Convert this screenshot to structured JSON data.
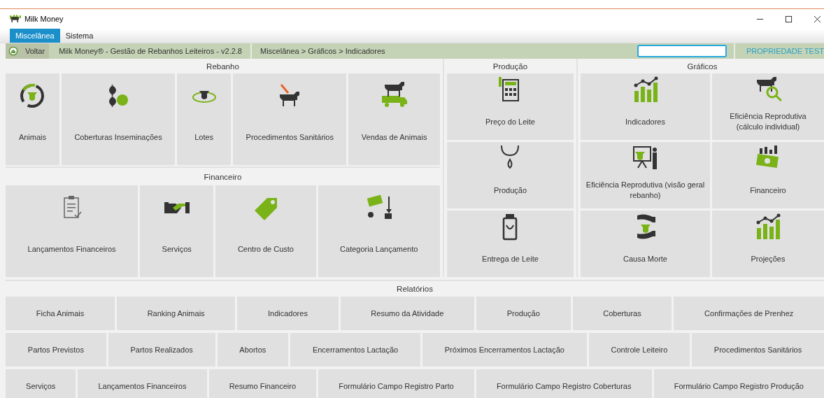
{
  "window": {
    "title": "Milk Money"
  },
  "menu": [
    {
      "label": "Miscelânea",
      "selected": true
    },
    {
      "label": "Sistema",
      "selected": false
    }
  ],
  "toolbar": {
    "back": "Voltar",
    "app_title": "Milk Money® - Gestão de Rebanhos Leiteiros - v2.2.8",
    "breadcrumb": "Miscelânea > Gráficos > Indicadores",
    "property": "PROPRIEDADE TEST"
  },
  "rebanho": {
    "title": "Rebanho",
    "tiles": [
      "Animais",
      "Coberturas Inseminações",
      "Lotes",
      "Procedimentos Sanitários",
      "Vendas de Animais"
    ]
  },
  "financeiro": {
    "title": "Financeiro",
    "tiles": [
      "Lançamentos Financeiros",
      "Serviços",
      "Centro de Custo",
      "Categoria Lançamento"
    ]
  },
  "producao": {
    "title": "Produção",
    "tiles": [
      "Preço do Leite",
      "Produção",
      "Entrega de Leite"
    ]
  },
  "graficos": {
    "title": "Gráficos",
    "tile_rows": [
      {
        "tiles": [
          "Indicadores",
          "Eficiência Reprodutiva (cálculo individual)"
        ]
      },
      {
        "tiles": [
          "Eficiência Reprodutiva (visão geral rebanho)",
          "Financeiro"
        ]
      },
      {
        "tiles": [
          "Causa Morte",
          "Projeções"
        ]
      }
    ]
  },
  "relatorios": {
    "title": "Relatórios",
    "button_groups": [
      {
        "buttons": [
          "Ficha Animais",
          "Ranking Animais",
          "Indicadores",
          "Resumo da Atividade",
          "Produção",
          "Coberturas",
          "Confirmações de Prenhez"
        ]
      },
      {
        "buttons": [
          "Partos Previstos",
          "Partos Realizados",
          "Abortos",
          "Encerramentos Lactação",
          "Próximos Encerramentos Lactação",
          "Controle Leiteiro",
          "Procedimentos Sanitários"
        ]
      },
      {
        "buttons": [
          "Serviços",
          "Lançamentos Financeiros",
          "Resumo Financeiro",
          "Formulário Campo Registro Parto",
          "Formulário Campo Registro Coberturas",
          "Formulário Campo Registro Produção"
        ]
      }
    ]
  }
}
